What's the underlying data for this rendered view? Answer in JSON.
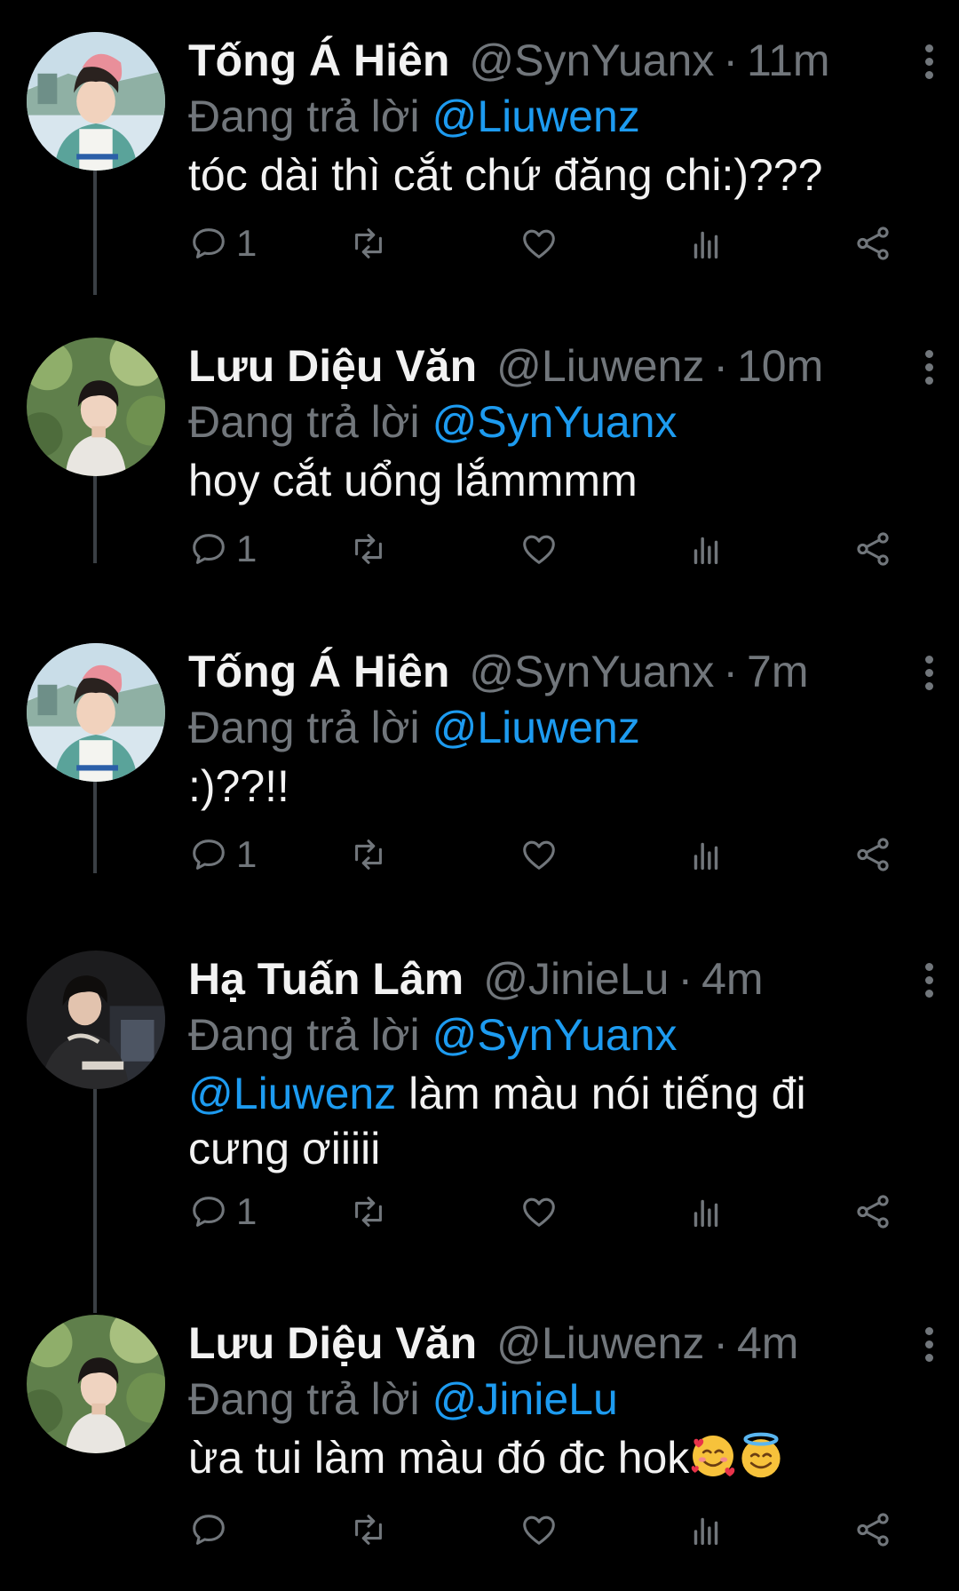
{
  "reply_prefix": "Đang trả lời",
  "tweets": [
    {
      "name": "Tống Á Hiên",
      "handle": "@SynYuanx",
      "sep": "·",
      "time": "11m",
      "reply_to": "@Liuwenz",
      "text": "tóc dài thì cắt chứ đăng chi:)???",
      "reply_count": "1",
      "avatar": "avatar-pink-beanie"
    },
    {
      "name": "Lưu Diệu Văn",
      "handle": "@Liuwenz",
      "sep": "·",
      "time": "10m",
      "reply_to": "@SynYuanx",
      "text": "hoy cắt uổng lắmmmm",
      "reply_count": "1",
      "avatar": "avatar-forest"
    },
    {
      "name": "Tống Á Hiên",
      "handle": "@SynYuanx",
      "sep": "·",
      "time": "7m",
      "reply_to": "@Liuwenz",
      "text": ":)??!!",
      "reply_count": "1",
      "avatar": "avatar-pink-beanie"
    },
    {
      "name": "Hạ Tuấn Lâm",
      "handle": "@JinieLu",
      "sep": "·",
      "time": "4m",
      "reply_to": "@SynYuanx",
      "text_mention": "@Liuwenz",
      "text_line1_rest": " làm màu nói tiếng đi",
      "text_line2": "cưng ơiiiii",
      "reply_count": "1",
      "avatar": "avatar-dark-hoodie"
    },
    {
      "name": "Lưu Diệu Văn",
      "handle": "@Liuwenz",
      "sep": "·",
      "time": "4m",
      "reply_to": "@JinieLu",
      "text": "ừa tui làm màu đó đc hok",
      "emojis": [
        "smiling-face-with-hearts",
        "smiling-face-with-halo"
      ],
      "reply_count": "",
      "avatar": "avatar-forest"
    }
  ],
  "colors": {
    "background": "#000000",
    "name": "#f2f2f2",
    "muted": "#71767b",
    "mention": "#1d9bf0",
    "thread_line": "#3a3f44"
  },
  "icons": [
    "reply-icon",
    "retweet-icon",
    "like-icon",
    "views-icon",
    "share-icon",
    "more-icon"
  ]
}
